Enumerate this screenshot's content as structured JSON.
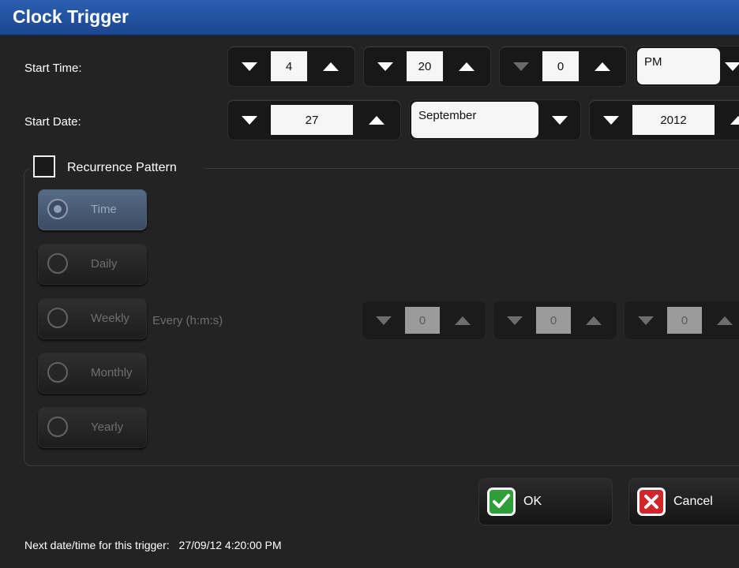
{
  "window": {
    "title": "Clock Trigger"
  },
  "start_time": {
    "label": "Start Time:",
    "hour": "4",
    "minute": "20",
    "second": "0",
    "ampm": "PM"
  },
  "start_date": {
    "label": "Start Date:",
    "day": "27",
    "month": "September",
    "year": "2012"
  },
  "recurrence": {
    "checkbox_label": "Recurrence Pattern",
    "checked": false,
    "options": [
      {
        "label": "Time",
        "selected": true
      },
      {
        "label": "Daily",
        "selected": false
      },
      {
        "label": "Weekly",
        "selected": false
      },
      {
        "label": "Monthly",
        "selected": false
      },
      {
        "label": "Yearly",
        "selected": false
      }
    ],
    "every_label": "Every (h:m:s)",
    "every_h": "0",
    "every_m": "0",
    "every_s": "0"
  },
  "buttons": {
    "ok": "OK",
    "cancel": "Cancel"
  },
  "footer": {
    "label": "Next date/time for this trigger:",
    "value": "27/09/12  4:20:00 PM"
  },
  "colors": {
    "title_bar": "#2a5fb0",
    "background": "#232323",
    "ok_green": "#2e9e38",
    "cancel_red": "#d2252a"
  }
}
